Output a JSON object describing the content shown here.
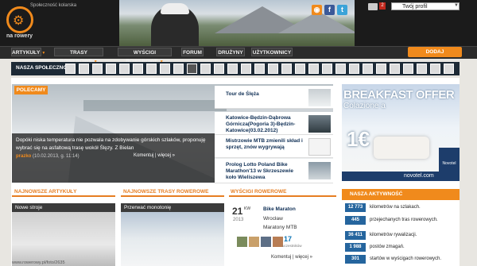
{
  "header": {
    "tagline": "Społeczność kolarska",
    "logo_name": "na rowery",
    "envelope_count": "2",
    "profile_label": "Twój profil"
  },
  "social_icons": [
    "rss-icon",
    "facebook-icon",
    "twitter-icon"
  ],
  "nav": {
    "items": [
      {
        "label": "ARTYKUŁY",
        "arrow": "▼"
      },
      {
        "label": "TRASY ROWEROWE",
        "arrow": "▼"
      },
      {
        "label": "WYŚCIGI ROWEROWE",
        "arrow": "▼"
      },
      {
        "label": "FORUM",
        "arrow": ""
      },
      {
        "label": "DRUŻYNY",
        "arrow": ""
      },
      {
        "label": "UŻYTKOWNICY",
        "arrow": ""
      }
    ],
    "search_label": "DODAJ"
  },
  "community": {
    "label": "NASZA SPOŁECZNOŚĆ:"
  },
  "featured": {
    "tag": "POLECAMY",
    "text": "Dopóki niska temperatura nie pozwala na zdobywanie górskich szlaków, proponuję wybrać się na asfaltową trasę wokół Ślęzy. Z Bielan",
    "meta_prefix": "prazko",
    "meta_date": "(10.02.2013, g. 11:14)",
    "meta_comment": "Komentuj | więcej »"
  },
  "side_list": [
    {
      "title": "Tour de Ślęża"
    },
    {
      "title": "Katowice-Będzin-Dąbrowa Górnicza(Pogoria 3)-Będzin-Katowice(03.02.2012)"
    },
    {
      "title": "Mistrzowie MTB zmienili skład i sprzęt, znów wygrywają"
    },
    {
      "title": "Prolog Lotto Poland Bike Marathon'13 w Skrzeszewie koło Wieliszewa"
    }
  ],
  "ad": {
    "title": "BREAKFAST OFFER",
    "subtitle": "Colazione a",
    "price": "1€",
    "brand": "Novotel",
    "bottom": "novotel.com"
  },
  "sections": {
    "articles": "NAJNOWSZE ARTYKUŁY",
    "routes": "NAJNOWSZE TRASY ROWEROWE",
    "races": "WYŚCIGI ROWEROWE",
    "activity": "NASZA AKTYWNOŚĆ"
  },
  "article_card": {
    "title": "Nowe stroje",
    "footer": "www.rowerowy.pl/foto/2635"
  },
  "route_card": {
    "title": "Przerwać monotonię"
  },
  "race": {
    "day": "21",
    "month": "KW",
    "year": "2013",
    "name": "Bike Maraton",
    "city": "Wrocław",
    "type": "Maratony MTB",
    "participants": "17",
    "participants_label": "uczestników",
    "actions": "Komentuj | więcej »"
  },
  "stats": [
    {
      "num": "12 773",
      "text": "kilometrów na szlakach."
    },
    {
      "num": "445",
      "text": "przejechanych tras rowerowych."
    },
    {
      "num": "36 411",
      "text": "kilometrów rywalizacji."
    },
    {
      "num": "1 988",
      "text": "postów zmagań."
    },
    {
      "num": "301",
      "text": "startów w wyścigach rowerowych."
    }
  ]
}
